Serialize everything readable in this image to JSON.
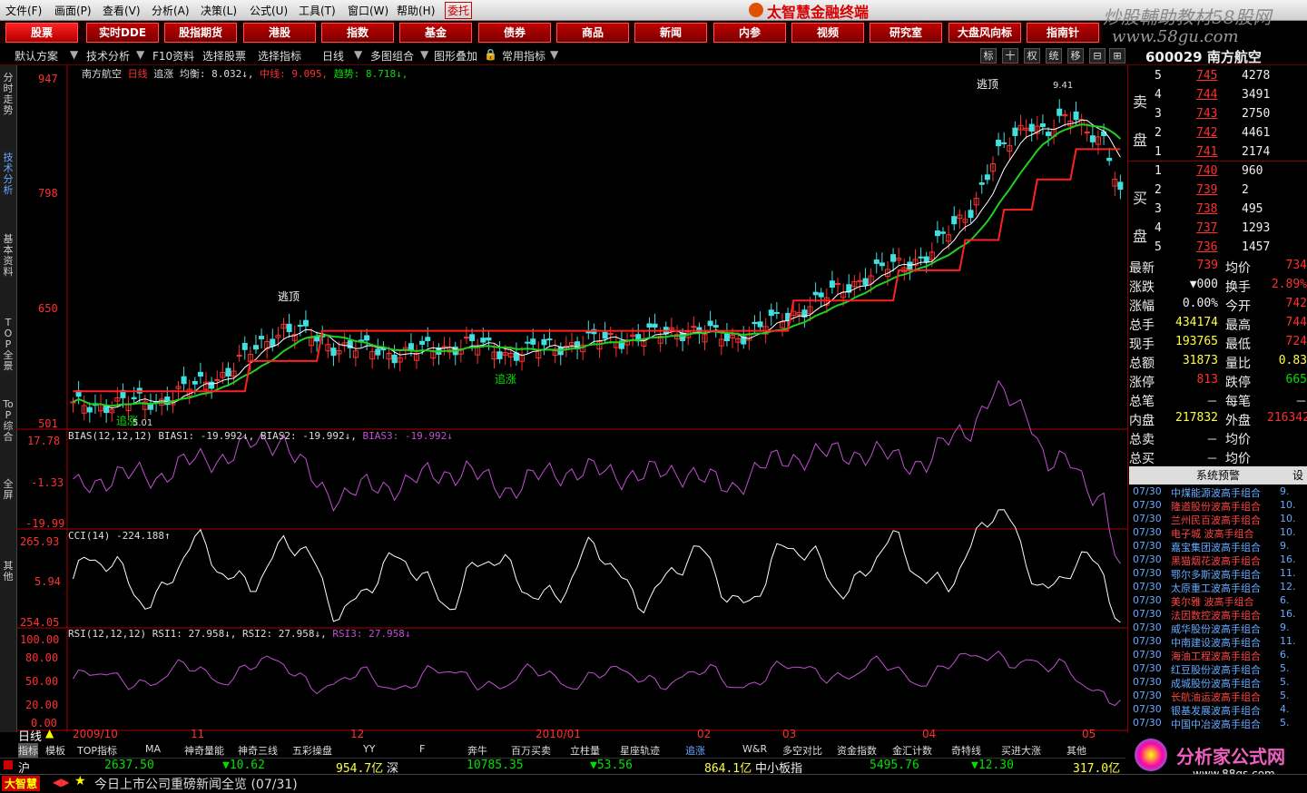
{
  "menu": [
    "文件(F)",
    "画面(P)",
    "查看(V)",
    "分析(A)",
    "决策(L)",
    "公式(U)",
    "工具(T)",
    "窗口(W)",
    "帮助(H)",
    "委托"
  ],
  "brand": "太智慧金融终端",
  "watermark": "炒股輔助教材58股网",
  "watermark_url": "www.58gu.com",
  "toolbar": [
    "股票",
    "实时DDE",
    "股指期货",
    "港股",
    "指数",
    "基金",
    "债券",
    "商品",
    "新闻",
    "内参",
    "视频",
    "研究室",
    "大盘风向标",
    "指南针"
  ],
  "row2": {
    "items": [
      "默认方案",
      "技术分析",
      "F10资料",
      "选择股票",
      "选择指标",
      "日线",
      "多图组合",
      "图形叠加",
      "常用指标"
    ],
    "right_icons": [
      "标",
      "十",
      "权",
      "统",
      "移",
      "⊟",
      "⊞"
    ],
    "stock_header": "600029 南方航空"
  },
  "left_tabs": [
    "分时走势",
    "技术分析",
    "基本资料",
    "TOP全景",
    "ToP综合",
    "全屏",
    "其他"
  ],
  "chart": {
    "title": "南方航空 日线 追涨 均衡: 8.032↓, 中线: 9.095, 趋势: 8.718↓",
    "title_parts": {
      "name": "南方航空",
      "period": "日线",
      "ind": "追涨",
      "a": "均衡: 8.032↓,",
      "b": "中线: 9.095,",
      "c": "趋势: 8.718↓,"
    },
    "y_labels": [
      "947",
      "798",
      "650",
      "501"
    ],
    "marks": {
      "escape_top": "逃顶",
      "chase": "追涨",
      "low_label": "5.01",
      "high_label": "9.41"
    },
    "bias": {
      "label": "BIAS(12,12,12) BIAS1: -19.992↓, BIAS2: -19.992↓,",
      "bias3": "BIAS3: -19.992↓",
      "y": [
        "17.78",
        "-1.33",
        "-19.99"
      ]
    },
    "cci": {
      "label": "CCI(14) -224.188↑",
      "y": [
        "265.93",
        "5.94",
        "254.05"
      ]
    },
    "rsi": {
      "label": "RSI(12,12,12) RSI1: 27.958↓, RSI2: 27.958↓,",
      "rsi3": "RSI3: 27.958↓",
      "y": [
        "100.00",
        "80.00",
        "50.00",
        "20.00",
        "0.00"
      ]
    },
    "x_labels": [
      "2009/10",
      "11",
      "12",
      "2010/01",
      "02",
      "03",
      "04",
      "05"
    ],
    "period_label": "日线"
  },
  "right": {
    "sell_label": "卖盘",
    "buy_label": "买盘",
    "sell": [
      [
        "5",
        "745",
        "4278"
      ],
      [
        "4",
        "744",
        "3491"
      ],
      [
        "3",
        "743",
        "2750"
      ],
      [
        "2",
        "742",
        "4461"
      ],
      [
        "1",
        "741",
        "2174"
      ]
    ],
    "buy": [
      [
        "1",
        "740",
        "960"
      ],
      [
        "2",
        "739",
        "2"
      ],
      [
        "3",
        "738",
        "495"
      ],
      [
        "4",
        "737",
        "1293"
      ],
      [
        "5",
        "736",
        "1457"
      ]
    ],
    "stats": [
      [
        "最新",
        "739",
        "均价",
        "734"
      ],
      [
        "涨跌",
        "▼000",
        "换手",
        "2.89%"
      ],
      [
        "涨幅",
        "0.00%",
        "今开",
        "742"
      ],
      [
        "总手",
        "434174",
        "最高",
        "744"
      ],
      [
        "现手",
        "193765",
        "最低",
        "724"
      ],
      [
        "总额",
        "31873",
        "量比",
        "0.83"
      ],
      [
        "涨停",
        "813",
        "跌停",
        "665"
      ],
      [
        "总笔",
        "－",
        "每笔",
        "－"
      ],
      [
        "内盘",
        "217832",
        "外盘",
        "216342"
      ],
      [
        "总卖",
        "－",
        "均价",
        ""
      ],
      [
        "总买",
        "－",
        "均价",
        ""
      ]
    ],
    "alert_title": "系统预警",
    "alerts": [
      [
        "07/30",
        "中煤能源波高手组合",
        "9."
      ],
      [
        "07/30",
        "隆道股份波高手组合",
        "10."
      ],
      [
        "07/30",
        "兰州民百波高手组合",
        "10."
      ],
      [
        "07/30",
        "电子城  波高手组合",
        "10."
      ],
      [
        "07/30",
        "嘉宝集团波高手组合",
        "9."
      ],
      [
        "07/30",
        "黑猫烟花波高手组合",
        "16."
      ],
      [
        "07/30",
        "鄂尔多斯波高手组合",
        "11."
      ],
      [
        "07/30",
        "太原重工波高手组合",
        "12."
      ],
      [
        "07/30",
        "美尔雅  波高手组合",
        "6."
      ],
      [
        "07/30",
        "法因数控波高手组合",
        "16."
      ],
      [
        "07/30",
        "威华股份波高手组合",
        "9."
      ],
      [
        "07/30",
        "中南建设波高手组合",
        "11."
      ],
      [
        "07/30",
        "海油工程波高手组合",
        "6."
      ],
      [
        "07/30",
        "红豆股份波高手组合",
        "5."
      ],
      [
        "07/30",
        "成城股份波高手组合",
        "5."
      ],
      [
        "07/30",
        "长航油运波高手组合",
        "5."
      ],
      [
        "07/30",
        "银基发展波高手组合",
        "4."
      ],
      [
        "07/30",
        "中国中冶波高手组合",
        "5."
      ]
    ]
  },
  "bottom_tabs": [
    "指标",
    "模板",
    "TOP指标",
    "MA",
    "神奇量能",
    "神奇三线",
    "五彩操盘",
    "YY",
    "F",
    "奔牛",
    "百万买卖",
    "立柱量",
    "星座轨迹",
    "追涨",
    "W&R",
    "多空对比",
    "资金指数",
    "金汇计数",
    "奇特线",
    "买进大涨",
    "其他"
  ],
  "ticker": {
    "sh": "沪",
    "sh_val": "2637.50",
    "sh_chg": "▼10.62",
    "sh_amt": "954.7亿",
    "sz": "深",
    "sz_val": "10785.35",
    "sz_chg": "▼53.56",
    "sz_amt": "864.1亿",
    "sme": "中小板指",
    "sme_val": "5495.76",
    "sme_chg": "▼12.30",
    "sme_amt": "317.0亿"
  },
  "news": {
    "app": "大智慧",
    "text": "今日上市公司重磅新闻全览 (07/31)"
  },
  "logo": "分析家公式网",
  "logo_url": "www.88gs.com"
}
